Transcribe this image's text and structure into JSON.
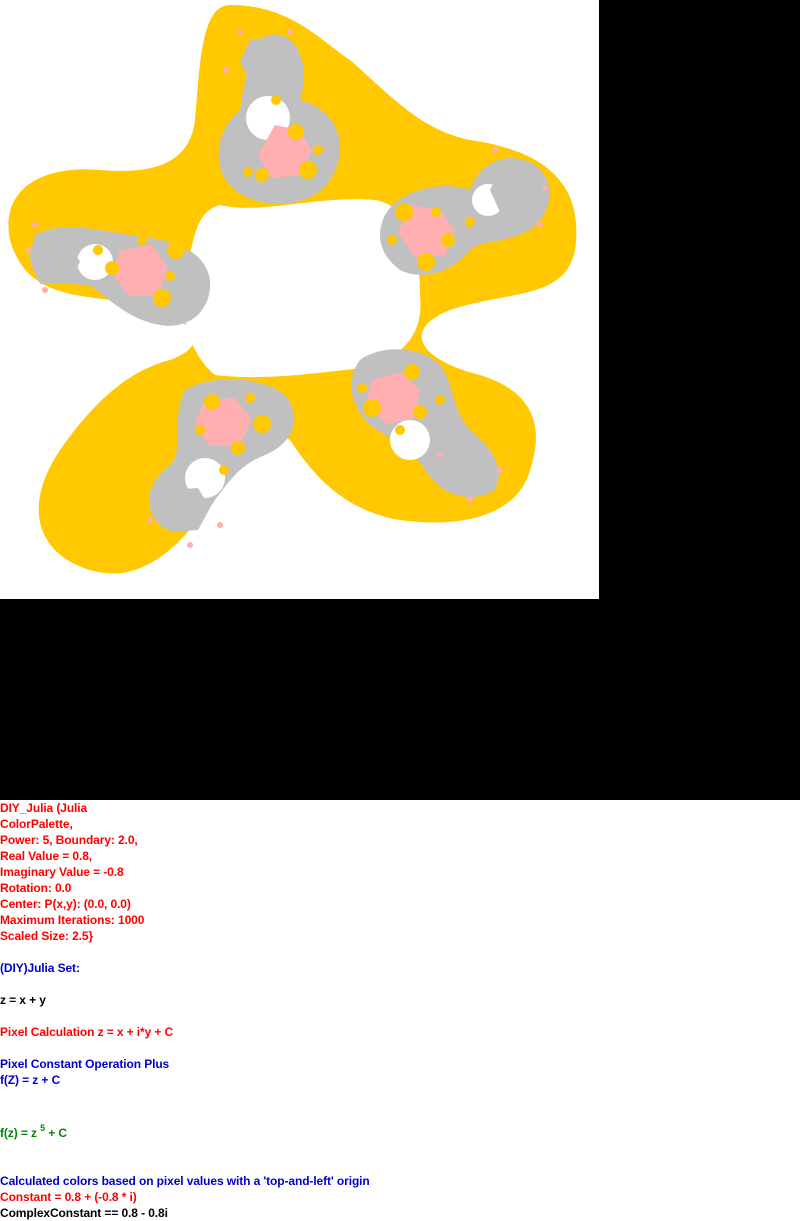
{
  "colors": {
    "background": "#000000",
    "canvas": "#ffffff",
    "outer_band": "#ffc800",
    "gray_lobe": "#c0c0c0",
    "pink_lobe": "#ffafaf",
    "detail": "#ffc800",
    "red_text": "#ff0000",
    "blue_text": "#0000cc",
    "black_text": "#000000",
    "green_text": "#008800"
  },
  "params": {
    "line1": "DIY_Julia (Julia",
    "line2": "ColorPalette,",
    "line3": "Power: 5, Boundary: 2.0,",
    "line4": "Real Value = 0.8,",
    "line5": "Imaginary Value = -0.8",
    "line6": "Rotation: 0.0",
    "line7": "Center: P(x,y): (0.0, 0.0)",
    "line8": "Maximum Iterations: 1000",
    "line9": "Scaled Size: 2.5}"
  },
  "title": "(DIY)Julia Set:",
  "z_def": "z = x + y",
  "pixel_calc": "Pixel Calculation z = x + i*y + C",
  "operation": "Pixel Constant Operation Plus",
  "f_plus": "f(Z) = z + C",
  "power_formula": {
    "prefix": "f(z) = z",
    "exponent": "5",
    "suffix": " + C"
  },
  "origin_note": "Calculated colors based on pixel values with a 'top-and-left' origin",
  "constant": "Constant = 0.8 + (-0.8 * i)",
  "complex_constant": "ComplexConstant == 0.8 - 0.8i"
}
